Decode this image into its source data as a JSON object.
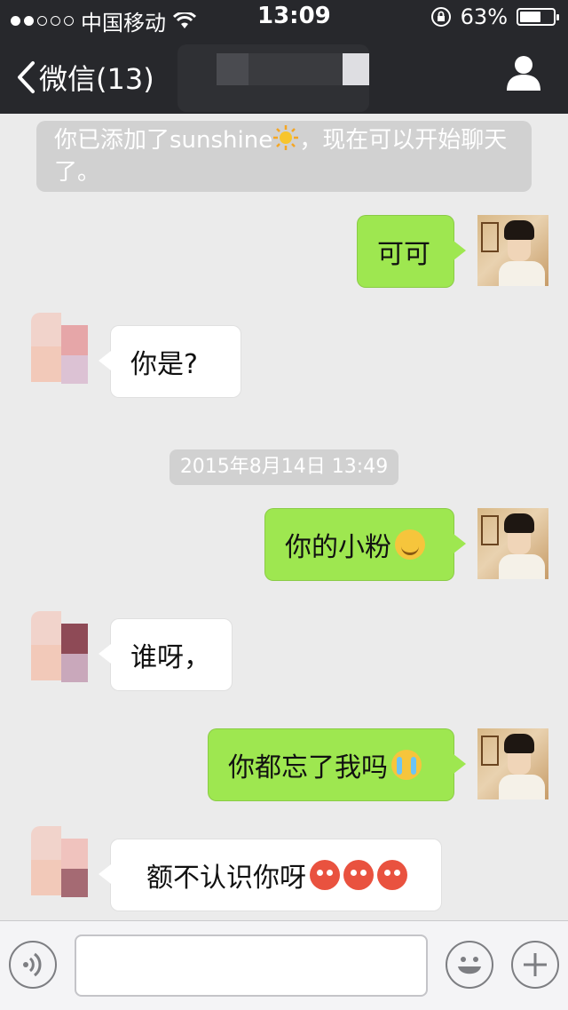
{
  "status_bar": {
    "carrier": "中国移动",
    "time": "13:09",
    "battery_percent": "63%",
    "battery_level": 0.63,
    "signal_bars": 2
  },
  "nav": {
    "back_label": "微信(13)"
  },
  "system_message": {
    "text_before": "你已添加了sunshine",
    "text_after": "，现在可以开始聊天了。",
    "icon": "sun-emoji-icon"
  },
  "timestamp": "2015年8月14日 13:49",
  "messages": [
    {
      "side": "out",
      "text": "可可"
    },
    {
      "side": "in",
      "text": "你是?"
    },
    {
      "side": "out",
      "text": "你的小粉",
      "emoji": "hug-emoji-icon"
    },
    {
      "side": "in",
      "text": "谁呀，"
    },
    {
      "side": "out",
      "text": "你都忘了我吗",
      "emoji": "crying-emoji-icon"
    },
    {
      "side": "in",
      "text": "额不认识你呀",
      "emoji": "blushing-emoji-icon x3"
    }
  ],
  "colors": {
    "nav_background": "#27282c",
    "outgoing_bubble": "#9ee750",
    "incoming_bubble": "#ffffff",
    "chat_background": "#ebebeb"
  },
  "toolbar": {
    "input_value": "",
    "voice_icon": "voice-icon",
    "emoji_icon": "emoji-face-icon",
    "plus_icon": "plus-icon"
  }
}
